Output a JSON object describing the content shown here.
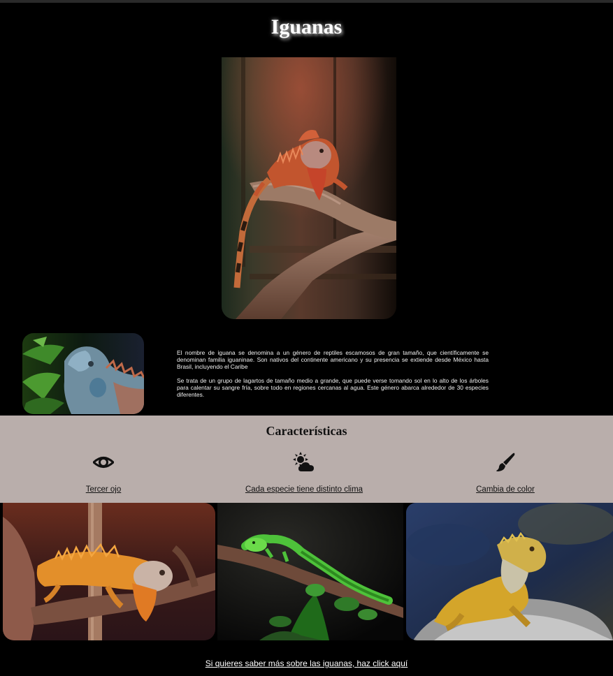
{
  "page": {
    "title": "Iguanas"
  },
  "intro": {
    "paragraph1": "El nombre de iguana se denomina a un género de reptiles escamosos de gran tamaño, que científicamente se denominan familia iguaninae. Son nativos del continente americano y su presencia se extiende desde México hasta Brasil, incluyendo el Caribe",
    "paragraph2": "Se trata de un grupo de lagartos de tamaño medio a grande, que puede verse tomando sol en lo alto de los árboles para calentar su sangre fría, sobre todo en regiones cercanas al agua. Este género abarca alrededor de 30 especies diferentes."
  },
  "features": {
    "title": "Características",
    "items": [
      {
        "label": "Tercer ojo",
        "icon": "eye-icon"
      },
      {
        "label": "Cada especie tiene distinto clima",
        "icon": "sun-cloud-icon"
      },
      {
        "label": "Cambia de color",
        "icon": "paintbrush-icon"
      }
    ]
  },
  "footer": {
    "link_text": "Si quieres saber más sobre las iguanas, haz click aquí"
  },
  "colors": {
    "background": "#000000",
    "features_band": "#b9aeab",
    "text_light": "#ffffff",
    "text_dark": "#111111"
  }
}
